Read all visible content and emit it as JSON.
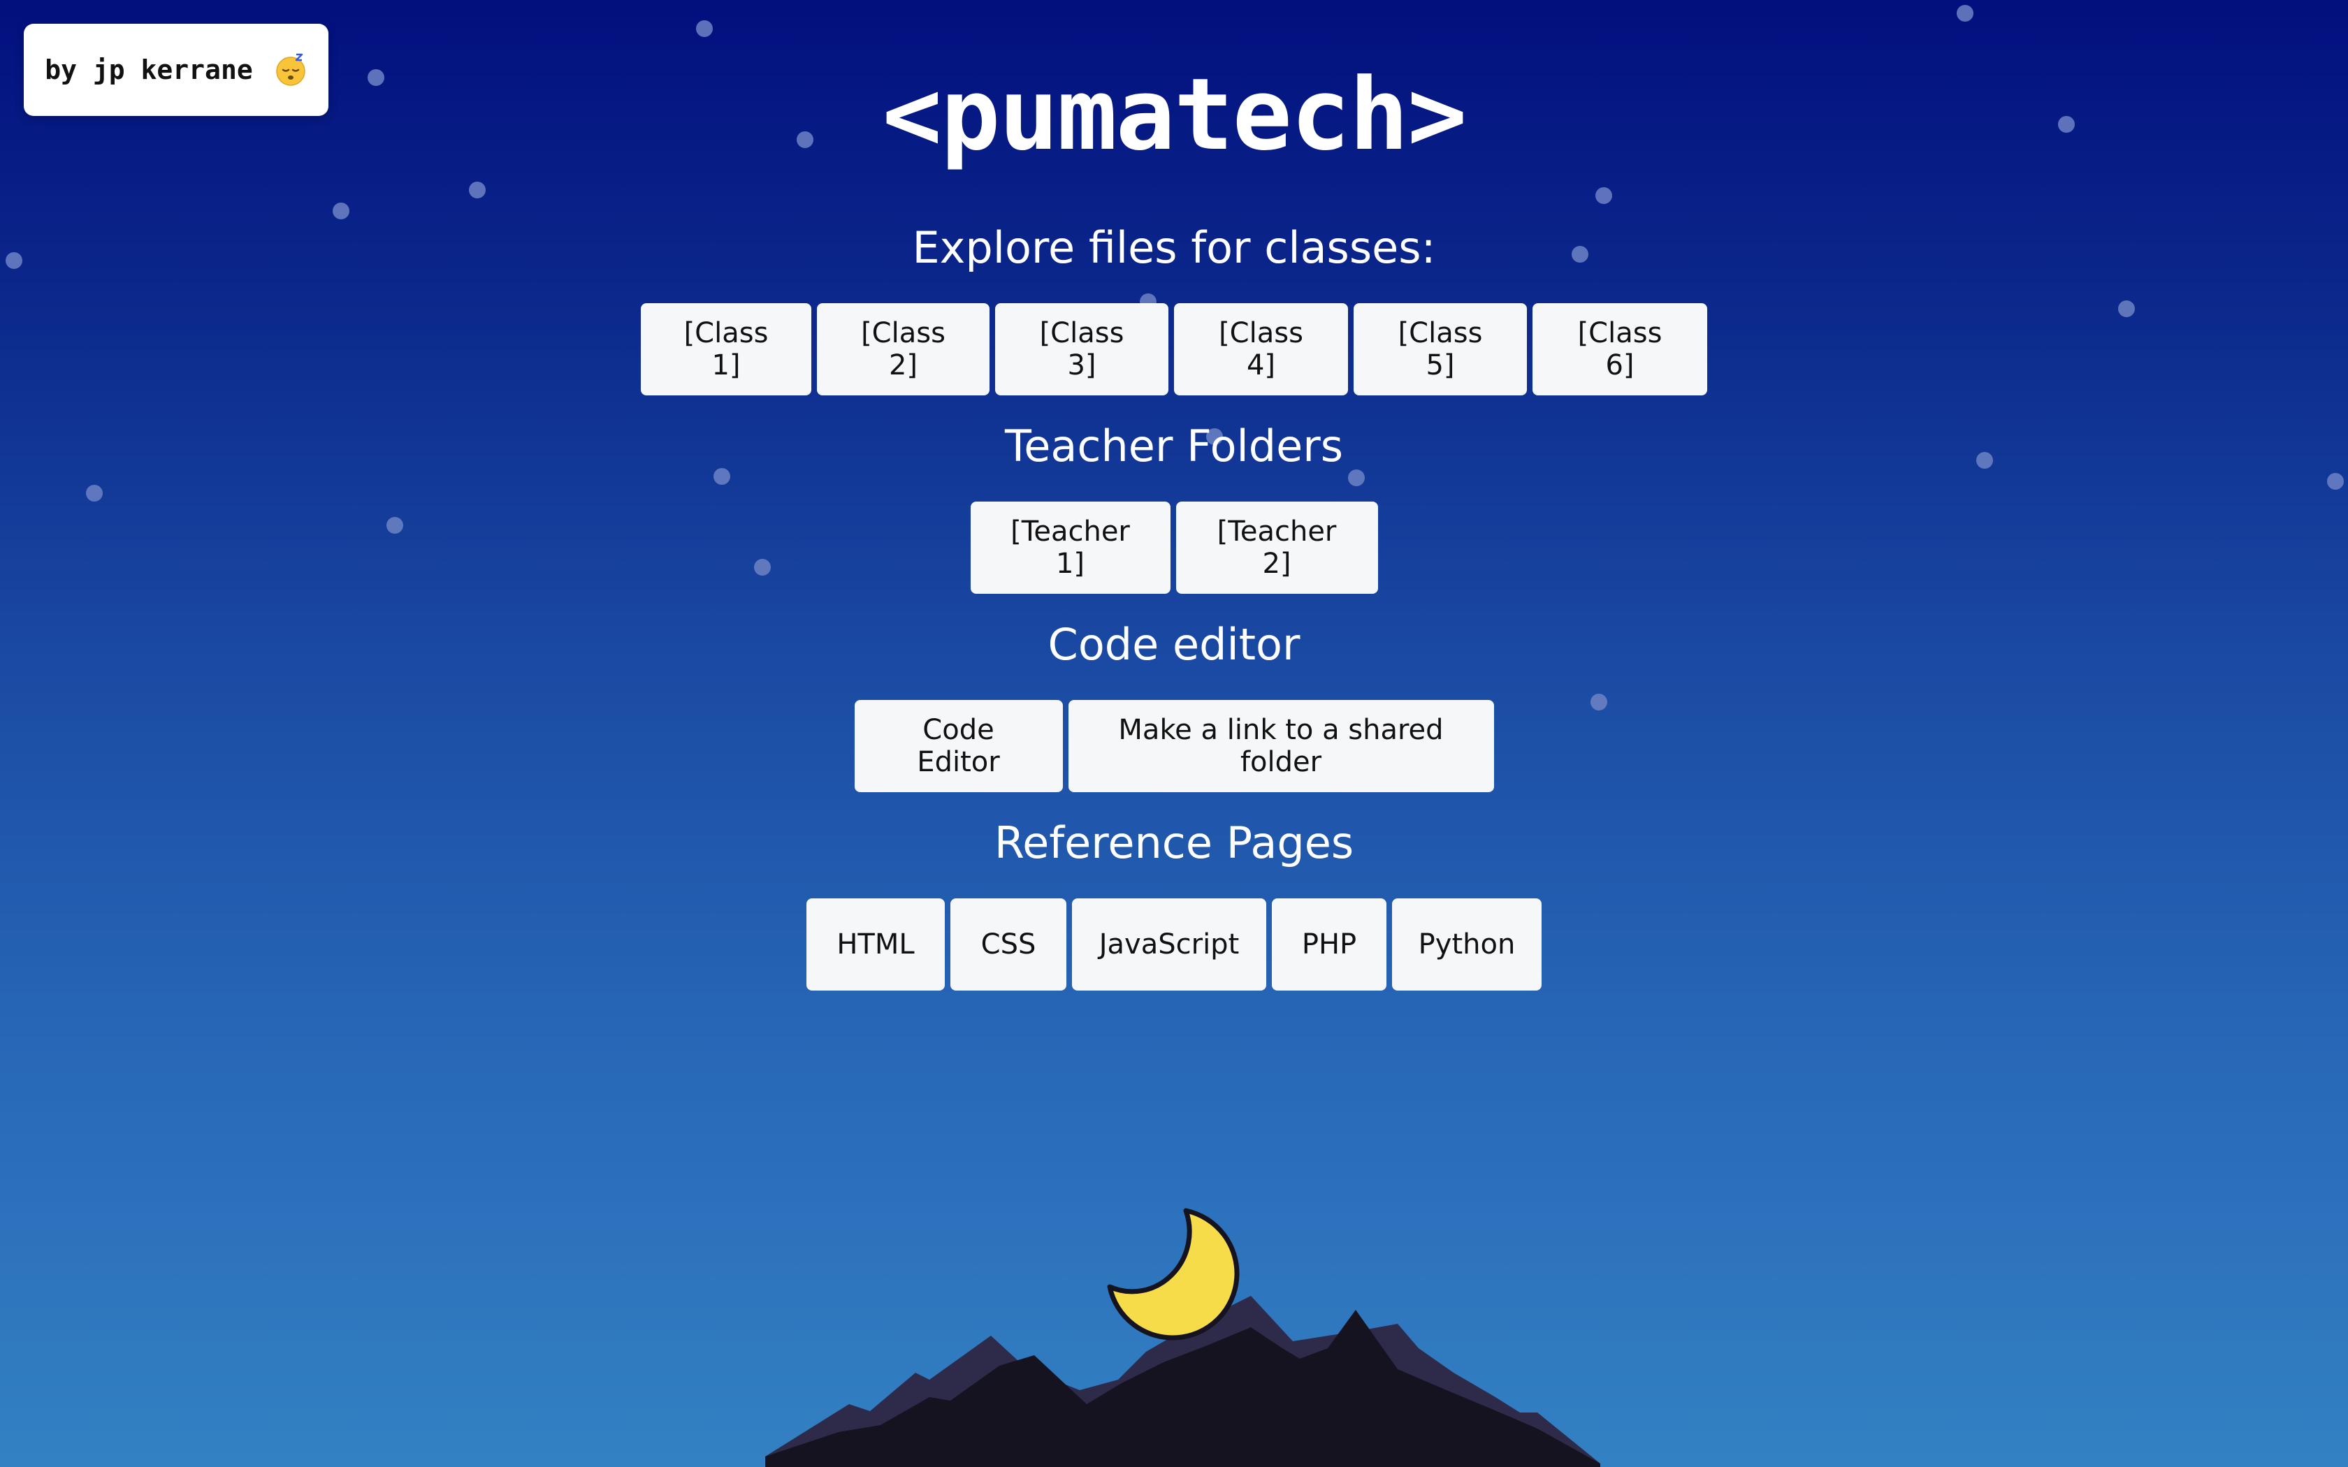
{
  "byline": {
    "text": "by jp kerrane",
    "emoji": "sleeping-face-icon"
  },
  "title": "<pumatech>",
  "sections": {
    "classes": {
      "heading": "Explore files for classes:",
      "buttons": [
        "[Class 1]",
        "[Class 2]",
        "[Class 3]",
        "[Class 4]",
        "[Class 5]",
        "[Class 6]"
      ]
    },
    "teachers": {
      "heading": "Teacher Folders",
      "buttons": [
        "[Teacher 1]",
        "[Teacher 2]"
      ]
    },
    "editor": {
      "heading": "Code editor",
      "buttons": [
        "Code Editor",
        "Make a link to a shared folder"
      ]
    },
    "reference": {
      "heading": "Reference Pages",
      "buttons": [
        "HTML",
        "CSS",
        "JavaScript",
        "PHP",
        "Python"
      ]
    }
  },
  "colors": {
    "sky_top": "#020f7e",
    "sky_bottom": "#3381c3",
    "moon": "#f7dc4a",
    "mountain_dark": "#15131f",
    "mountain_back": "#2e2a4a"
  }
}
